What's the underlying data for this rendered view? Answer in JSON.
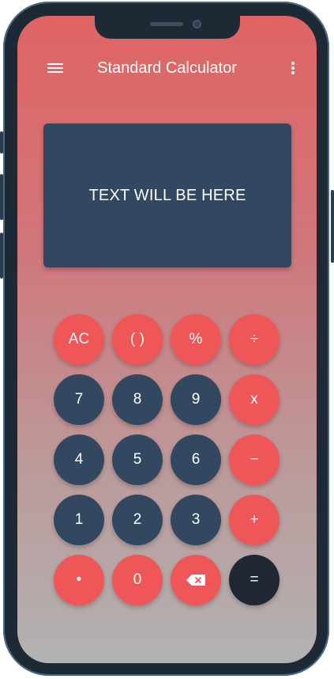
{
  "app": {
    "title": "Standard Calculator",
    "menu_icon": "hamburger-menu-icon",
    "more_icon": "more-vertical-icon"
  },
  "display": {
    "text": "TEXT WILL BE HERE"
  },
  "keypad": {
    "rows": [
      [
        {
          "label": "AC",
          "style": "red"
        },
        {
          "label": "( )",
          "style": "red"
        },
        {
          "label": "%",
          "style": "red"
        },
        {
          "label": "÷",
          "style": "red"
        }
      ],
      [
        {
          "label": "7",
          "style": "dark"
        },
        {
          "label": "8",
          "style": "dark"
        },
        {
          "label": "9",
          "style": "dark"
        },
        {
          "label": "x",
          "style": "red"
        }
      ],
      [
        {
          "label": "4",
          "style": "dark"
        },
        {
          "label": "5",
          "style": "dark"
        },
        {
          "label": "6",
          "style": "dark"
        },
        {
          "label": "−",
          "style": "red"
        }
      ],
      [
        {
          "label": "1",
          "style": "dark"
        },
        {
          "label": "2",
          "style": "dark"
        },
        {
          "label": "3",
          "style": "dark"
        },
        {
          "label": "+",
          "style": "red"
        }
      ],
      [
        {
          "label": "•",
          "style": "red"
        },
        {
          "label": "0",
          "style": "red"
        },
        {
          "label": "",
          "icon": "backspace-icon",
          "style": "red"
        },
        {
          "label": "=",
          "style": "black"
        }
      ]
    ]
  },
  "colors": {
    "accent_red": "#ef5657",
    "key_dark": "#324860",
    "key_equals": "#1f2733",
    "background_top": "#e06464",
    "background_bottom": "#b2b2b2"
  }
}
